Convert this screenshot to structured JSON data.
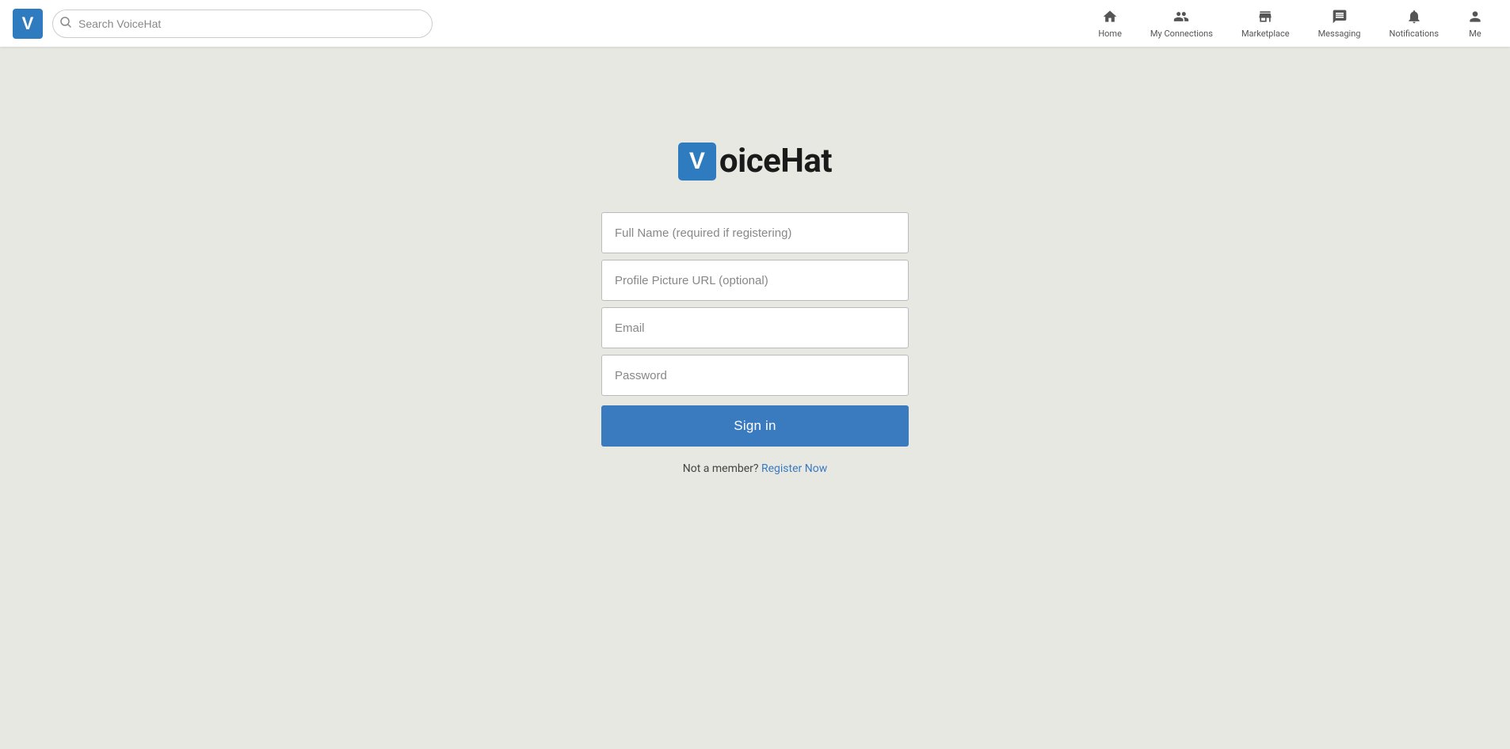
{
  "header": {
    "logo_letter": "V",
    "search_placeholder": "Search VoiceHat",
    "nav_items": [
      {
        "id": "home",
        "label": "Home",
        "icon": "🏠"
      },
      {
        "id": "my-connections",
        "label": "My Connections",
        "icon": "👥"
      },
      {
        "id": "marketplace",
        "label": "Marketplace",
        "icon": "🏪"
      },
      {
        "id": "messaging",
        "label": "Messaging",
        "icon": "💬"
      },
      {
        "id": "notifications",
        "label": "Notifications",
        "icon": "🔔"
      },
      {
        "id": "me",
        "label": "Me",
        "icon": "👤"
      }
    ]
  },
  "brand": {
    "logo_letter": "V",
    "name_suffix": "oiceHat"
  },
  "form": {
    "full_name_placeholder": "Full Name (required if registering)",
    "profile_pic_placeholder": "Profile Picture URL (optional)",
    "email_placeholder": "Email",
    "password_placeholder": "Password",
    "signin_label": "Sign in",
    "not_member_text": "Not a member?",
    "register_label": "Register Now"
  }
}
